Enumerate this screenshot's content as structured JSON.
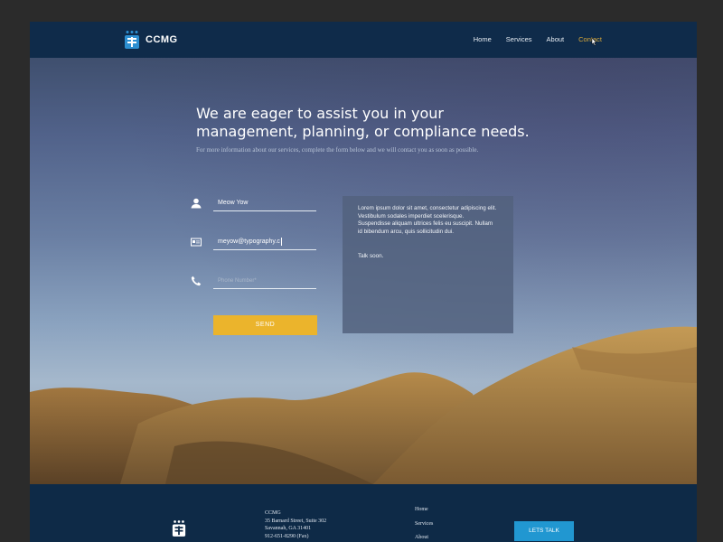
{
  "brand": {
    "name": "CCMG"
  },
  "nav": {
    "items": [
      {
        "label": "Home"
      },
      {
        "label": "Services"
      },
      {
        "label": "About"
      },
      {
        "label": "Contact"
      }
    ],
    "active": "Contact"
  },
  "hero": {
    "headline_line1": "We are eager to assist you in your",
    "headline_line2": "management, planning, or compliance needs.",
    "subline": "For more information about our services, complete the form below and we will contact you as soon as possible."
  },
  "form": {
    "name_value": "Meow Yow",
    "email_value": "meyow@typography.c",
    "phone_placeholder": "Phone Number*",
    "submit_label": "SEND"
  },
  "message": {
    "body": "Lorem ipsum dolor sit amet, consectetur adipiscing elit. Vestibulum sodales imperdiet scelerisque. Suspendisse aliquam ultrices felis eu suscipit. Nullam id bibendum arcu, quis sollicitudin dui.",
    "signoff": "Talk soon."
  },
  "footer": {
    "address_line1": "CCMG",
    "address_line2": "35 Barnard Street, Suite 302",
    "address_line3": "Savannah, GA 31401",
    "address_line4": "912-651-8290 (Fax)",
    "links": [
      {
        "label": "Home"
      },
      {
        "label": "Services"
      },
      {
        "label": "About"
      }
    ],
    "cta_label": "LETS TALK"
  },
  "colors": {
    "nav_bg": "#0f2b4a",
    "accent_gold": "#ebb42c",
    "cta_blue": "#2197d1",
    "active_link": "#d8a83a"
  }
}
